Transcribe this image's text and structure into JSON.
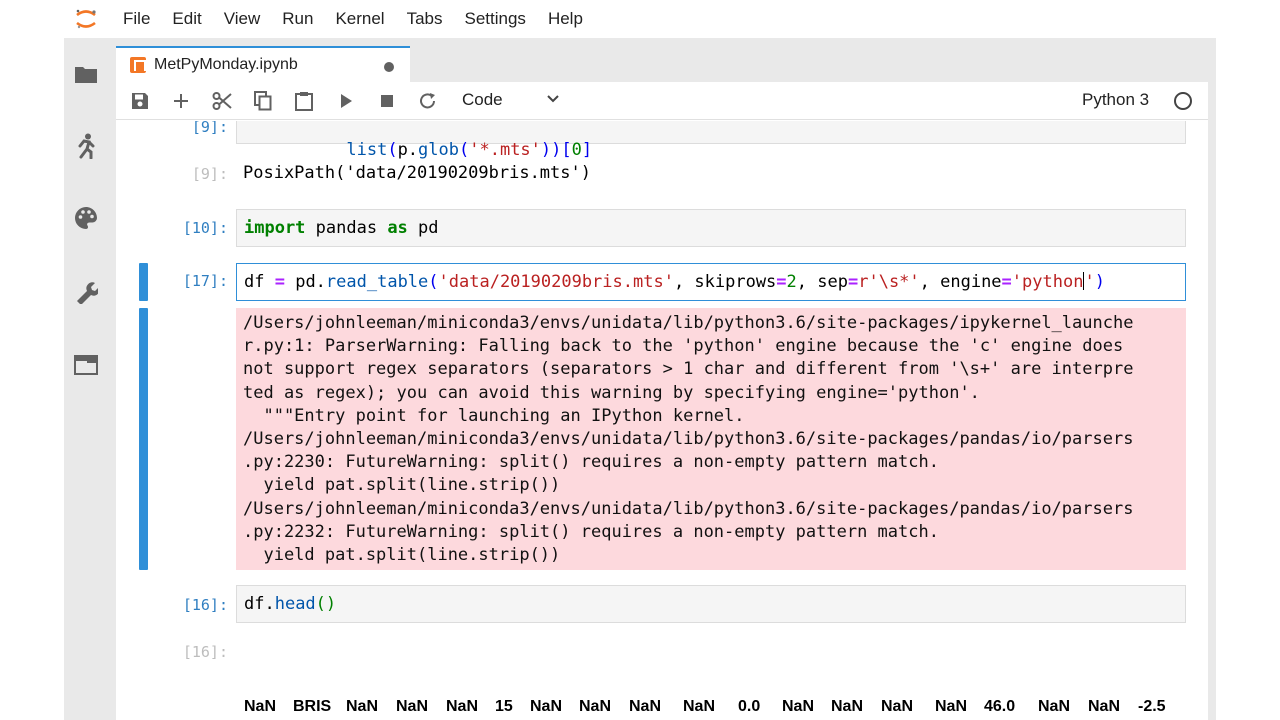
{
  "menubar": {
    "items": [
      "File",
      "Edit",
      "View",
      "Run",
      "Kernel",
      "Tabs",
      "Settings",
      "Help"
    ]
  },
  "sidebar": {
    "icons": [
      "folder-icon",
      "running-icon",
      "palette-icon",
      "wrench-icon",
      "tabs-icon"
    ]
  },
  "tab": {
    "title": "MetPyMonday.ipynb"
  },
  "toolbar": {
    "cell_type": "Code",
    "kernel": "Python 3"
  },
  "cells": {
    "c1": {
      "prompt": "[9]:",
      "code": "list(p.glob('*.mts'))[0]"
    },
    "c1_out": {
      "prompt": "[9]:",
      "text": "PosixPath('data/20190209bris.mts')"
    },
    "c2": {
      "prompt": "[10]:",
      "code_kw1": "import",
      "code_mid": " pandas ",
      "code_kw2": "as",
      "code_end": " pd"
    },
    "c3": {
      "prompt": "[17]:",
      "parts": [
        "df ",
        "=",
        " pd.",
        "read_table",
        "(",
        "'data/20190209bris.mts'",
        ", skiprows",
        "=",
        "2",
        ", sep",
        "=",
        "r'\\s*'",
        ", engine",
        "=",
        "'python",
        "'",
        ")"
      ]
    },
    "stderr_lines": [
      "/Users/johnleeman/miniconda3/envs/unidata/lib/python3.6/site-packages/ipykernel_launche",
      "r.py:1: ParserWarning: Falling back to the 'python' engine because the 'c' engine does",
      "not support regex separators (separators > 1 char and different from '\\s+' are interpre",
      "ted as regex); you can avoid this warning by specifying engine='python'.",
      "  \"\"\"Entry point for launching an IPython kernel.",
      "/Users/johnleeman/miniconda3/envs/unidata/lib/python3.6/site-packages/pandas/io/parsers",
      ".py:2230: FutureWarning: split() requires a non-empty pattern match.",
      "  yield pat.split(line.strip())",
      "/Users/johnleeman/miniconda3/envs/unidata/lib/python3.6/site-packages/pandas/io/parsers",
      ".py:2232: FutureWarning: split() requires a non-empty pattern match.",
      "  yield pat.split(line.strip())"
    ],
    "c4": {
      "prompt": "[16]:",
      "code_obj": "df.",
      "code_fn": "head",
      "code_par": "()"
    },
    "c4_out": {
      "prompt": "[16]:"
    },
    "dataframe_row": [
      "NaN",
      "BRIS",
      "NaN",
      "NaN",
      "NaN",
      "15",
      "NaN",
      "NaN",
      "NaN",
      "NaN",
      "0.0",
      "NaN",
      "NaN",
      "NaN",
      "NaN",
      "46.0",
      "NaN",
      "NaN",
      "-2.5"
    ]
  }
}
